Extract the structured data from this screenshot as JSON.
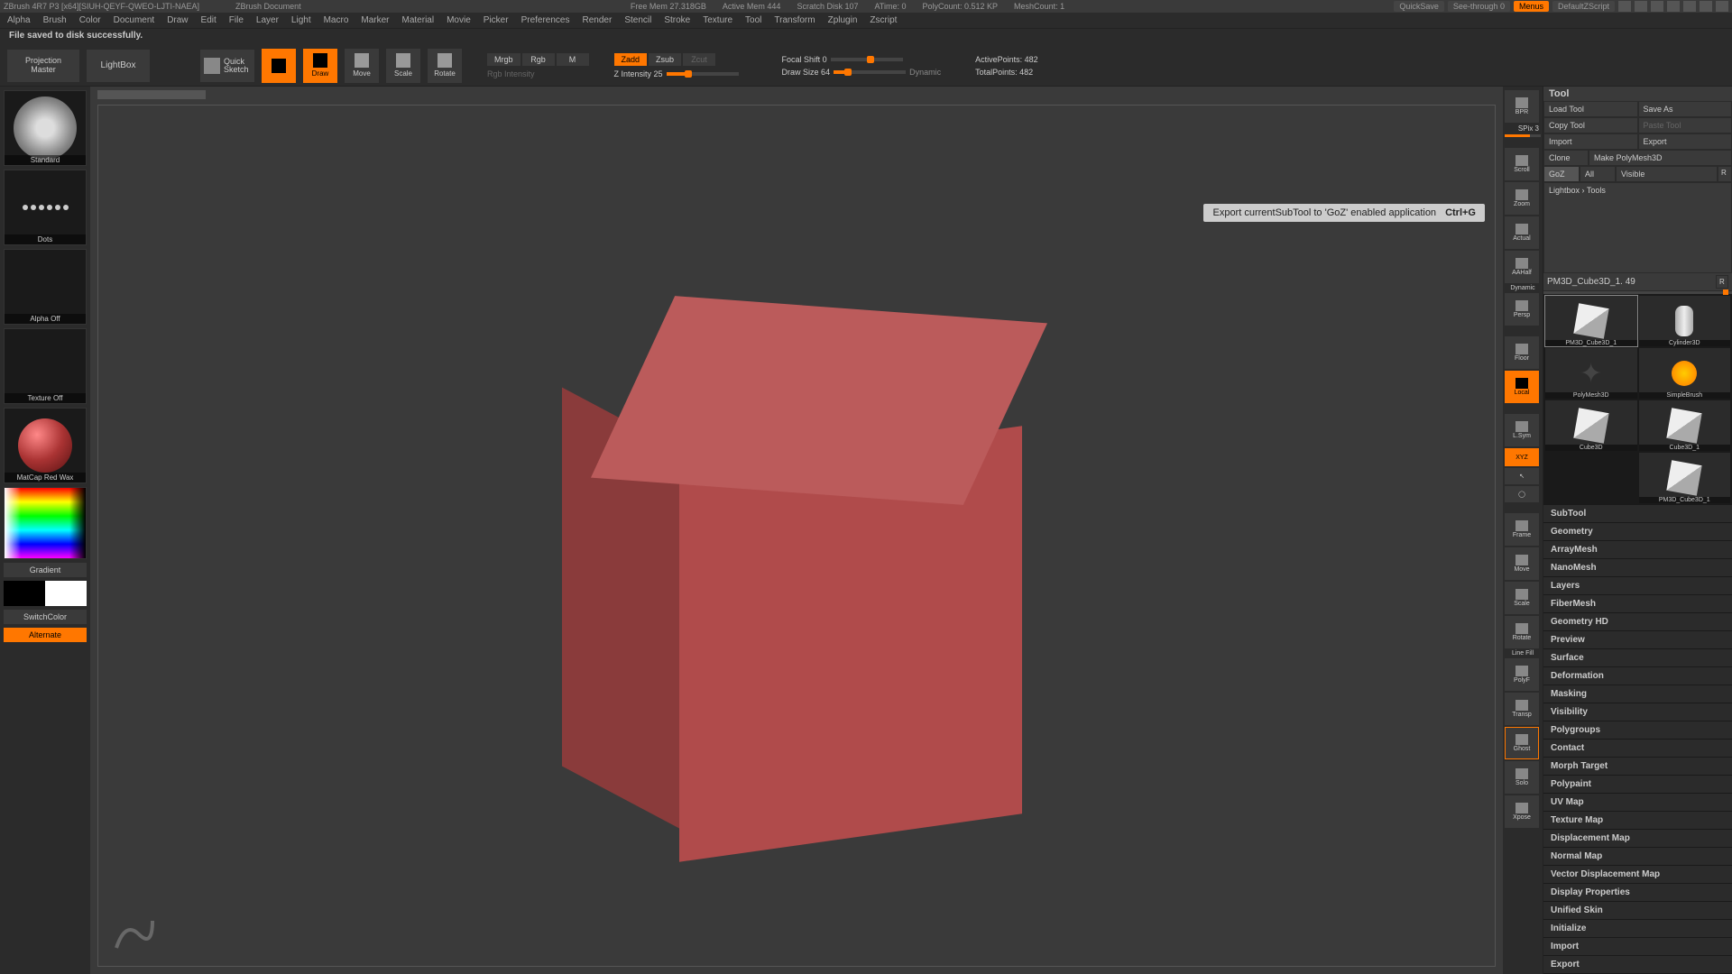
{
  "titlebar": {
    "left": "ZBrush 4R7 P3 [x64][SIUH-QEYF-QWEO-LJTI-NAEA]",
    "doc": "ZBrush Document",
    "stats": [
      "Free Mem 27.318GB",
      "Active Mem 444",
      "Scratch Disk 107",
      "ATime: 0",
      "PolyCount: 0.512 KP",
      "MeshCount: 1"
    ],
    "quicksave": "QuickSave",
    "seethrough": "See-through  0",
    "menus": "Menus",
    "script": "DefaultZScript"
  },
  "menubar": [
    "Alpha",
    "Brush",
    "Color",
    "Document",
    "Draw",
    "Edit",
    "File",
    "Layer",
    "Light",
    "Macro",
    "Marker",
    "Material",
    "Movie",
    "Picker",
    "Preferences",
    "Render",
    "Stencil",
    "Stroke",
    "Texture",
    "Tool",
    "Transform",
    "Zplugin",
    "Zscript"
  ],
  "status": "File saved to disk successfully.",
  "toolbar": {
    "proj1": "Projection",
    "proj2": "Master",
    "lightbox": "LightBox",
    "sketch1": "Quick",
    "sketch2": "Sketch",
    "icons": [
      "Edit",
      "Draw",
      "Move",
      "Scale",
      "Rotate"
    ],
    "mode_row1": [
      "Mrgb",
      "Rgb",
      "M"
    ],
    "mode_row1_lbl": "Rgb Intensity",
    "mode_row2": [
      "Zadd",
      "Zsub",
      "Zcut"
    ],
    "mode_row2_lbl": "Z Intensity 25",
    "focal": "Focal Shift 0",
    "draw": "Draw Size 64",
    "dynamic": "Dynamic",
    "active": "ActivePoints: 482",
    "total": "TotalPoints: 482"
  },
  "left": {
    "brush": "Standard",
    "stroke": "Dots",
    "alpha": "Alpha Off",
    "texture": "Texture Off",
    "material": "MatCap Red Wax",
    "gradient": "Gradient",
    "switch": "SwitchColor",
    "alternate": "Alternate"
  },
  "rightstrip": {
    "spix": "SPix 3",
    "items": [
      "BPR",
      "Scroll",
      "Zoom",
      "Actual",
      "AAHalf",
      "Persp",
      "Floor",
      "Local",
      "L.Sym",
      "XYZ",
      "Frame",
      "Move",
      "Scale",
      "Rotate",
      "PolyF",
      "Transp",
      "Ghost",
      "Solo",
      "Xpose"
    ],
    "dynamic": "Dynamic",
    "linefill": "Line Fill"
  },
  "tooltip": {
    "text": "Export currentSubTool to 'GoZ' enabled application",
    "key": "Ctrl+G"
  },
  "rightpanel": {
    "header": "Tool",
    "row1": [
      "Load Tool",
      "Save As"
    ],
    "row2": [
      "Copy Tool",
      "Paste Tool"
    ],
    "row3": [
      "Import",
      "Export"
    ],
    "row4": [
      "Clone",
      "Make PolyMesh3D"
    ],
    "row5": [
      "GoZ",
      "All",
      "Visible",
      "R"
    ],
    "lightbox": "Lightbox › Tools",
    "toolname": "PM3D_Cube3D_1. 49",
    "r": "R",
    "thumbs": [
      "PM3D_Cube3D_1",
      "Cylinder3D",
      "PolyMesh3D",
      "SimpleBrush",
      "Cube3D",
      "Cube3D_1",
      "PM3D_Cube3D_1"
    ],
    "sections": [
      "SubTool",
      "Geometry",
      "ArrayMesh",
      "NanoMesh",
      "Layers",
      "FiberMesh",
      "Geometry HD",
      "Preview",
      "Surface",
      "Deformation",
      "Masking",
      "Visibility",
      "Polygroups",
      "Contact",
      "Morph Target",
      "Polypaint",
      "UV Map",
      "Texture Map",
      "Displacement Map",
      "Normal Map",
      "Vector Displacement Map",
      "Display Properties",
      "Unified Skin",
      "Initialize",
      "Import",
      "Export"
    ]
  }
}
